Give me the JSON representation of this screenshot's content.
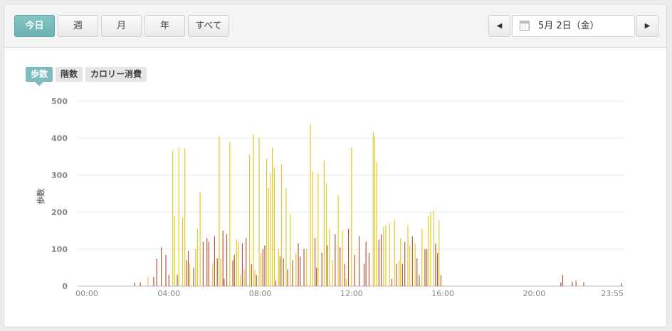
{
  "toolbar": {
    "periods": [
      "今日",
      "週",
      "月",
      "年",
      "すべて"
    ],
    "active_period": 0,
    "prev_icon": "triangle-left-icon",
    "next_icon": "triangle-right-icon",
    "calendar_icon": "calendar-icon",
    "date_label": "5月 2日（金）"
  },
  "metric_tabs": {
    "items": [
      "歩数",
      "階数",
      "カロリー消費"
    ],
    "active": 0
  },
  "colors": {
    "accent": "#7fbcbd",
    "bar_yellow": "#e0cb2e",
    "bar_red": "#b5573a",
    "grid": "#e8e8e8",
    "axis_text": "#888888"
  },
  "chart_data": {
    "type": "bar",
    "ylabel": "歩数",
    "ylim": [
      0,
      500
    ],
    "yticks": [
      0,
      100,
      200,
      300,
      400,
      500
    ],
    "xlim": [
      0,
      1435
    ],
    "xticks": [
      {
        "value": 0,
        "label": "00:00"
      },
      {
        "value": 240,
        "label": "04:00"
      },
      {
        "value": 480,
        "label": "08:00"
      },
      {
        "value": 720,
        "label": "12:00"
      },
      {
        "value": 960,
        "label": "16:00"
      },
      {
        "value": 1200,
        "label": "20:00"
      },
      {
        "value": 1435,
        "label": "23:55"
      }
    ],
    "bar_interval_minutes": 5,
    "series": [
      {
        "color": "yellow",
        "x": [
          185,
          250,
          255,
          266,
          276,
          282,
          295,
          310,
          315,
          322,
          355,
          372,
          376,
          400,
          418,
          423,
          428,
          438,
          452,
          462,
          466,
          477,
          482,
          497,
          502,
          507,
          512,
          517,
          528,
          536,
          548,
          559,
          574,
          602,
          612,
          618,
          632,
          648,
          654,
          662,
          670,
          685,
          696,
          706,
          720,
          777,
          781,
          786,
          804,
          810,
          820,
          833,
          845,
          849,
          868,
          873,
          887,
          905,
          922,
          928,
          936,
          950
        ],
        "values": [
          25,
          365,
          190,
          375,
          185,
          372,
          60,
          100,
          155,
          255,
          60,
          405,
          75,
          390,
          125,
          120,
          30,
          45,
          355,
          410,
          45,
          400,
          90,
          345,
          265,
          305,
          375,
          320,
          100,
          330,
          265,
          195,
          90,
          100,
          440,
          310,
          305,
          340,
          275,
          155,
          70,
          245,
          150,
          20,
          375,
          415,
          405,
          335,
          160,
          165,
          170,
          180,
          70,
          130,
          165,
          110,
          115,
          155,
          190,
          200,
          205,
          178
        ]
      },
      {
        "color": "red",
        "x": [
          150,
          165,
          200,
          208,
          220,
          232,
          240,
          262,
          287,
          291,
          305,
          330,
          340,
          345,
          360,
          367,
          382,
          385,
          392,
          408,
          412,
          433,
          443,
          457,
          470,
          487,
          492,
          521,
          532,
          541,
          552,
          565,
          580,
          585,
          595,
          624,
          628,
          642,
          656,
          677,
          690,
          702,
          712,
          728,
          740,
          753,
          758,
          766,
          792,
          798,
          826,
          838,
          854,
          860,
          880,
          892,
          898,
          913,
          918,
          941,
          946,
          955,
          1270,
          1275,
          1300,
          1310,
          1330,
          1430
        ],
        "values": [
          10,
          10,
          25,
          75,
          105,
          85,
          30,
          30,
          70,
          95,
          50,
          120,
          130,
          120,
          135,
          75,
          150,
          20,
          140,
          70,
          85,
          115,
          130,
          60,
          30,
          100,
          110,
          15,
          80,
          75,
          45,
          70,
          115,
          80,
          100,
          130,
          50,
          90,
          110,
          140,
          105,
          60,
          155,
          85,
          135,
          60,
          120,
          90,
          125,
          140,
          20,
          60,
          60,
          120,
          135,
          75,
          30,
          100,
          100,
          115,
          90,
          30,
          10,
          30,
          12,
          15,
          10,
          8
        ]
      }
    ]
  }
}
